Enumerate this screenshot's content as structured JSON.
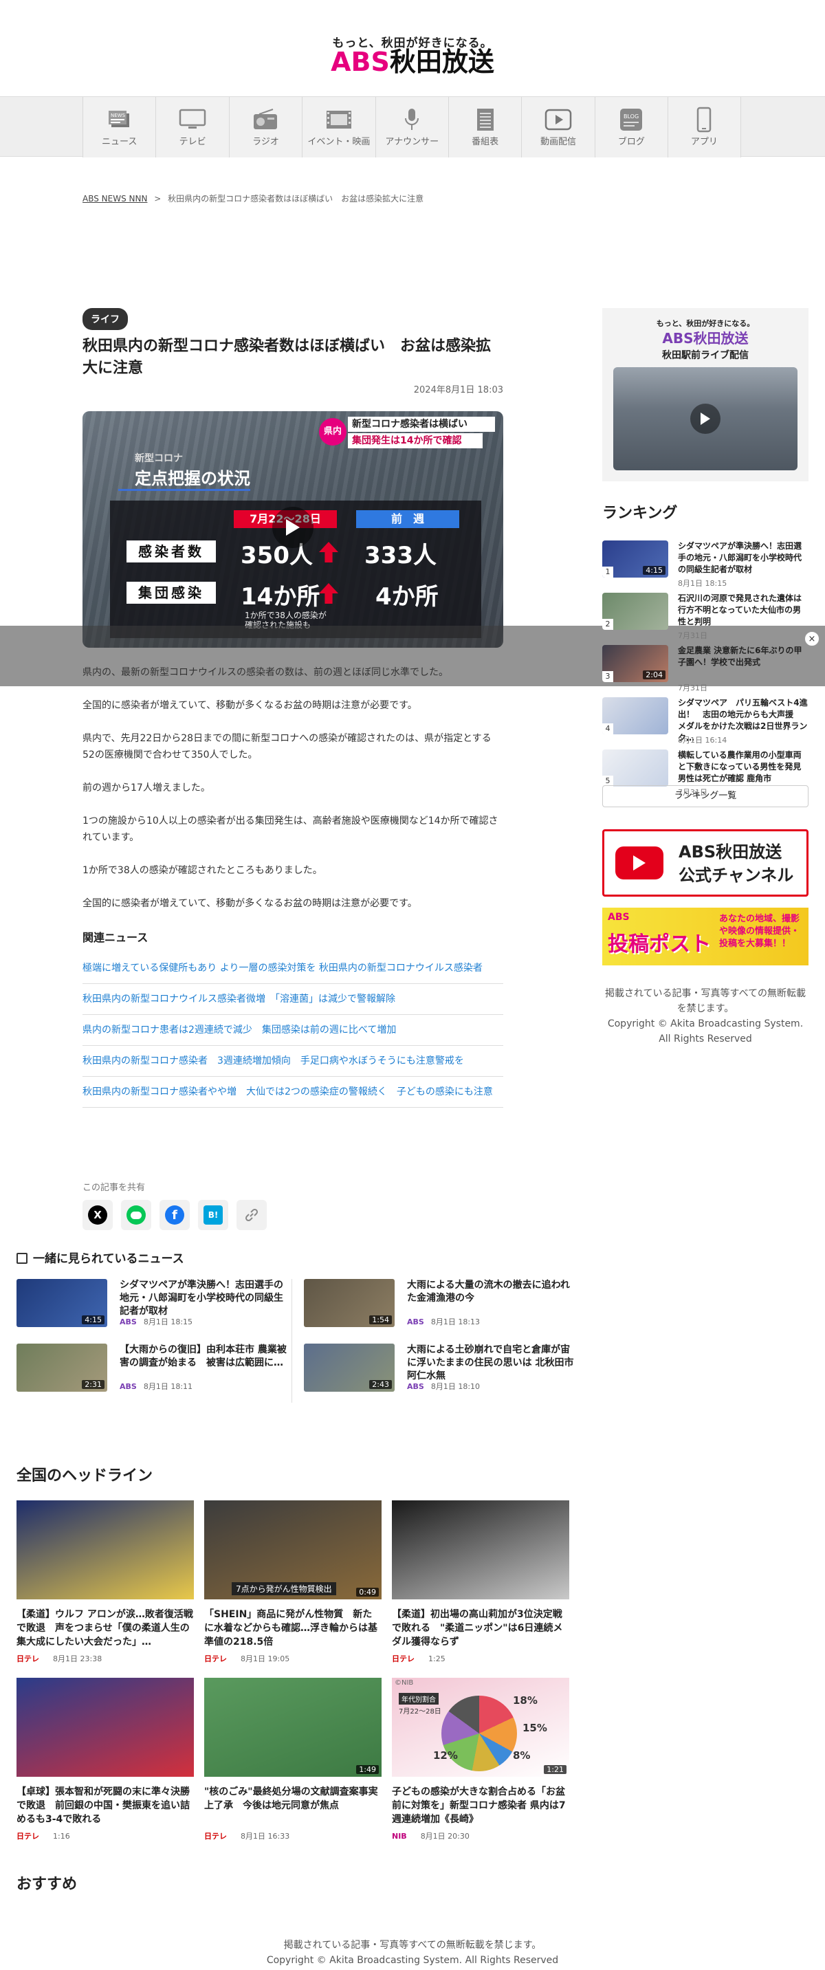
{
  "header": {
    "tagline": "もっと、秋田が好きになる。",
    "logo_abs": "ABS",
    "logo_name": "秋田放送"
  },
  "nav": [
    {
      "label": "ニュース",
      "icon": "news-icon"
    },
    {
      "label": "テレビ",
      "icon": "tv-icon"
    },
    {
      "label": "ラジオ",
      "icon": "radio-icon"
    },
    {
      "label": "イベント・映画",
      "icon": "film-icon"
    },
    {
      "label": "アナウンサー",
      "icon": "microphone-icon"
    },
    {
      "label": "番組表",
      "icon": "schedule-icon"
    },
    {
      "label": "動画配信",
      "icon": "video-play-icon"
    },
    {
      "label": "ブログ",
      "icon": "blog-icon"
    },
    {
      "label": "アプリ",
      "icon": "smartphone-icon"
    }
  ],
  "breadcrumb": {
    "home": "ABS NEWS NNN",
    "sep": ">",
    "current": "秋田県内の新型コロナ感染者数はほぼ横ばい　お盆は感染拡大に注意"
  },
  "article": {
    "category": "ライフ",
    "title": "秋田県内の新型コロナ感染者数はほぼ横ばい　お盆は感染拡大に注意",
    "date": "2024年8月1日 18:03",
    "video": {
      "badge_pref": "県内",
      "headline1": "新型コロナ感染者は横ばい",
      "headline2": "集団発生は14か所で確認",
      "sub": "新型コロナ",
      "board_title": "定点把握の状況",
      "col1": "7月22〜28日",
      "col2": "前　週",
      "row1_label": "感染者数",
      "row1_v1": "350人",
      "row1_v2": "333人",
      "row2_label": "集団感染",
      "row2_v1": "14か所",
      "row2_v2": "4か所",
      "note1": "1か所で38人の感染が",
      "note2": "確認された施設も"
    },
    "paragraphs": [
      "県内の、最新の新型コロナウイルスの感染者の数は、前の週とほぼ同じ水準でした。",
      "全国的に感染者が増えていて、移動が多くなるお盆の時期は注意が必要です。",
      "県内で、先月22日から28日までの間に新型コロナへの感染が確認されたのは、県が指定とする52の医療機関で合わせて350人でした。",
      "前の週から17人増えました。",
      "1つの施設から10人以上の感染者が出る集団発生は、高齢者施設や医療機関など14か所で確認されています。",
      "1か所で38人の感染が確認されたところもありました。",
      "全国的に感染者が増えていて、移動が多くなるお盆の時期は注意が必要です。"
    ],
    "related_title": "関連ニュース",
    "related": [
      "極端に増えている保健所もあり より一層の感染対策を 秋田県内の新型コロナウイルス感染者",
      "秋田県内の新型コロナウイルス感染者微増　「溶連菌」は減少で警報解除",
      "県内の新型コロナ患者は2週連続で減少　集団感染は前の週に比べて増加",
      "秋田県内の新型コロナ感染者　3週連続増加傾向　手足口病や水ぼうそうにも注意警戒を",
      "秋田県内の新型コロナ感染者やや増　大仙では2つの感染症の警報続く　子どもの感染にも注意"
    ],
    "share_label": "この記事を共有"
  },
  "sidebar": {
    "live_tagline": "もっと、秋田が好きになる。",
    "live_logo": "ABS秋田放送",
    "live_title": "秋田駅前ライブ配信",
    "ranking_title": "ランキング",
    "ranking": [
      {
        "num": "1",
        "title": "シダマツペアが準決勝へ！志田選手の地元・八郎潟町を小学校時代の同級生記者が取材",
        "date": "8月1日 18:15",
        "dur": "4:15"
      },
      {
        "num": "2",
        "title": "石沢川の河原で発見された遺体は行方不明となっていた大仙市の男性と判明",
        "date": "7月31日",
        "dur": ""
      },
      {
        "num": "3",
        "title": "金足農業 決意新たに6年ぶりの甲子園へ！学校で出発式",
        "date": "7月31日",
        "dur": "2:04"
      },
      {
        "num": "4",
        "title": "シダマツペア　パリ五輪ベスト4進出！　志田の地元からも大声援　メダルをかけた次戦は2日世界ランク…",
        "date": "8月1日 16:14",
        "dur": ""
      },
      {
        "num": "5",
        "title": "横転している農作業用の小型車両と下敷きになっている男性を発見　男性は死亡が確認 鹿角市",
        "date": "7月31日",
        "dur": ""
      }
    ],
    "ranking_button": "ランキング一覧",
    "yt_line1": "ABS秋田放送",
    "yt_line2": "公式チャンネル",
    "post_logo": "ABS",
    "post_title": "投稿ポスト",
    "post_text": "あなたの地域、撮影や映像の情報提供・投稿を大募集！！",
    "copyright1": "掲載されている記事・写真等すべての無断転載を禁じます。",
    "copyright2": "Copyright © Akita Broadcasting System. All Rights Reserved"
  },
  "together": {
    "title": "一緒に見られているニュース",
    "items": [
      {
        "title": "シダマツペアが準決勝へ！志田選手の地元・八郎潟町を小学校時代の同級生記者が取材",
        "source": "ABS",
        "date": "8月1日 18:15",
        "dur": "4:15"
      },
      {
        "title": "大雨による大量の流木の撤去に追われた金浦漁港の今",
        "source": "ABS",
        "date": "8月1日 18:13",
        "dur": "1:54"
      },
      {
        "title": "【大雨からの復旧】由利本荘市 農業被害の調査が始まる　被害は広範囲に…",
        "source": "ABS",
        "date": "8月1日 18:11",
        "dur": "2:31"
      },
      {
        "title": "大雨による土砂崩れで自宅と倉庫が宙に浮いたままの住民の思いは 北秋田市阿仁水無",
        "source": "ABS",
        "date": "8月1日 18:10",
        "dur": "2:43"
      }
    ]
  },
  "headlines": {
    "title": "全国のヘッドライン",
    "items": [
      {
        "title": "【柔道】ウルフ アロンが涙…敗者復活戦で敗退　声をつまらせ「僕の柔道人生の集大成にしたい大会だった」…",
        "source": "日テレ",
        "date": "8月1日 23:38",
        "dur": ""
      },
      {
        "title": "「SHEIN」商品に発がん性物質　新たに水着などからも確認…浮き輪からは基準値の218.5倍",
        "source": "日テレ",
        "date": "8月1日 19:05",
        "dur": "0:49",
        "caption": "7点から発がん性物質検出"
      },
      {
        "title": "【柔道】初出場の高山莉加が3位決定戦で敗れる　\"柔道ニッポン\"は6日連続メダル獲得ならず",
        "source": "日テレ",
        "date": "1:25",
        "dur": ""
      },
      {
        "title": "【卓球】張本智和が死闘の末に準々決勝で敗退　前回銀の中国・樊振東を追い詰めるも3-4で敗れる",
        "source": "日テレ",
        "date": "1:16",
        "dur": ""
      },
      {
        "title": "\"核のごみ\"最終処分場の文献調査案事実上了承　今後は地元同意が焦点",
        "source": "日テレ",
        "date": "8月1日 16:33",
        "dur": "1:49"
      },
      {
        "title": "子どもの感染が大きな割合占める「お盆前に対策を」新型コロナ感染者 県内は7週連続増加《長崎》",
        "source": "NIB",
        "date": "8月1日 20:30",
        "dur": "1:21",
        "chart_label1": "年代別割合",
        "chart_label2": "7月22〜28日",
        "p1": "18%",
        "p2": "15%",
        "p3": "8%",
        "p4": "12%",
        "credit": "©NIB"
      }
    ]
  },
  "osusume": "おすすめ",
  "footer": {
    "copyright1": "掲載されている記事・写真等すべての無断転載を禁じます。",
    "copyright2": "Copyright © Akita Broadcasting System. All Rights Reserved"
  }
}
